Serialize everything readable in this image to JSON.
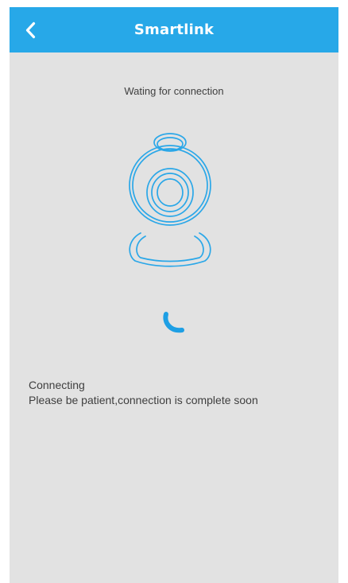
{
  "app": {
    "title": "Smartlink",
    "accent_color": "#27a8e8"
  },
  "header": {
    "back_icon": "chevron-left-icon",
    "title": "Smartlink"
  },
  "main": {
    "status_text": "Wating for connection",
    "camera_icon": "webcam-outline-icon",
    "spinner_icon": "loading-arc-icon",
    "message_title": "Connecting",
    "message_body": "Please be patient,connection is complete soon"
  }
}
